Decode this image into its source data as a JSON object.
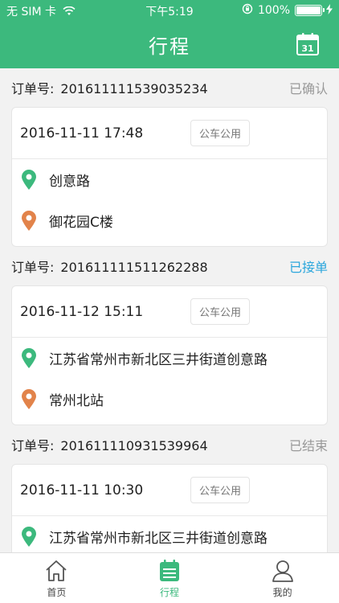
{
  "status_bar": {
    "carrier": "无 SIM 卡",
    "time": "下午5:19",
    "battery": "100%",
    "battery_level": 1.0
  },
  "header": {
    "title": "行程",
    "calendar_day": "31"
  },
  "orders": [
    {
      "label": "订单号:",
      "number": "2016111115390352​34",
      "status": "已确认",
      "status_active": false,
      "time": "2016-11-11 17:48",
      "tag": "公车公用",
      "start": "创意路",
      "end": "御花园C楼"
    },
    {
      "label": "订单号:",
      "number": "2016111115112622​88",
      "status": "已接单",
      "status_active": true,
      "time": "2016-11-12 15:11",
      "tag": "公车公用",
      "start": "江苏省常州市新北区三井街道创意路",
      "end": "常州北站"
    },
    {
      "label": "订单号:",
      "number": "2016111109315399​64",
      "status": "已结束",
      "status_active": false,
      "time": "2016-11-11 10:30",
      "tag": "公车公用",
      "start": "江苏省常州市新北区三井街道创意路",
      "end": ""
    }
  ],
  "tabbar": {
    "items": [
      {
        "label": "首页",
        "icon": "home-icon",
        "active": false
      },
      {
        "label": "行程",
        "icon": "itinerary-icon",
        "active": true
      },
      {
        "label": "我的",
        "icon": "profile-icon",
        "active": false
      }
    ]
  },
  "colors": {
    "primary": "#3cb97d",
    "status_active": "#2ba6dc",
    "start_pin": "#3cb97d",
    "end_pin": "#e2834a"
  }
}
